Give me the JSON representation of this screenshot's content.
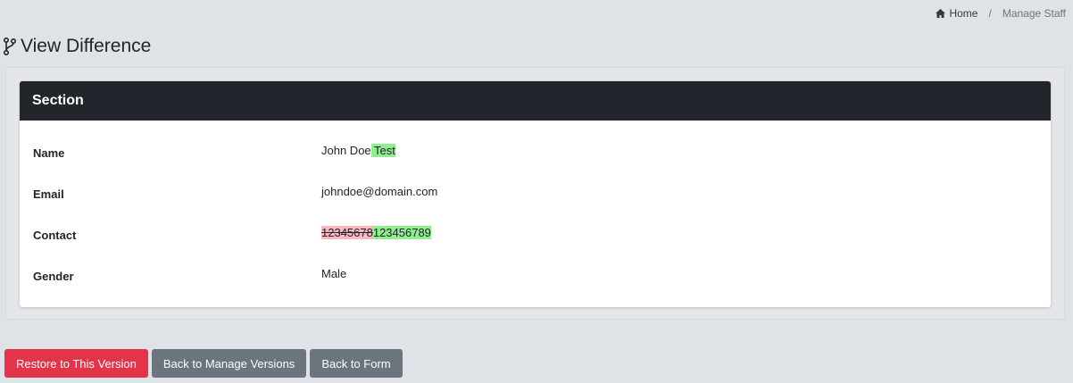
{
  "breadcrumb": {
    "home": "Home",
    "separator": "/",
    "current": "Manage Staff"
  },
  "page": {
    "title": "View Difference"
  },
  "section": {
    "header": "Section",
    "rows": [
      {
        "label": "Name",
        "value": "John Doe",
        "inserted": " Test"
      },
      {
        "label": "Email",
        "value": "johndoe@domain.com"
      },
      {
        "label": "Contact",
        "deleted": "12345678",
        "inserted": "123456789"
      },
      {
        "label": "Gender",
        "value": "Male"
      }
    ]
  },
  "actions": {
    "restore": "Restore to This Version",
    "back_versions": "Back to Manage Versions",
    "back_form": "Back to Form"
  },
  "colors": {
    "insert_bg": "#90ee90",
    "delete_bg": "#ffb6c1",
    "danger": "#e3344a",
    "secondary": "#6c757d",
    "header_bg": "#22252b"
  }
}
